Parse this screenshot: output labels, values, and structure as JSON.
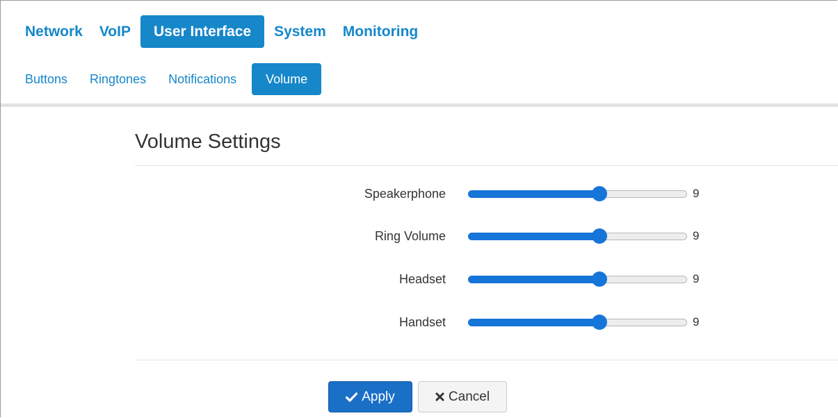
{
  "main_nav": {
    "items": [
      {
        "label": "Network"
      },
      {
        "label": "VoIP"
      },
      {
        "label": "User Interface",
        "active": true
      },
      {
        "label": "System"
      },
      {
        "label": "Monitoring"
      }
    ]
  },
  "sub_nav": {
    "items": [
      {
        "label": "Buttons"
      },
      {
        "label": "Ringtones"
      },
      {
        "label": "Notifications"
      },
      {
        "label": "Volume",
        "active": true
      }
    ]
  },
  "section": {
    "title": "Volume Settings"
  },
  "sliders": [
    {
      "label": "Speakerphone",
      "value": "9",
      "min": 0,
      "max": 15,
      "level": 9
    },
    {
      "label": "Ring Volume",
      "value": "9",
      "min": 0,
      "max": 15,
      "level": 9
    },
    {
      "label": "Headset",
      "value": "9",
      "min": 0,
      "max": 15,
      "level": 9
    },
    {
      "label": "Handset",
      "value": "9",
      "min": 0,
      "max": 15,
      "level": 9
    }
  ],
  "actions": {
    "apply_label": "Apply",
    "cancel_label": "Cancel"
  },
  "icons": {
    "apply": "check-icon",
    "cancel": "times-icon"
  },
  "colors": {
    "accent": "#1687c9",
    "slider": "#1675d8",
    "apply_button": "#1a6fc6"
  }
}
